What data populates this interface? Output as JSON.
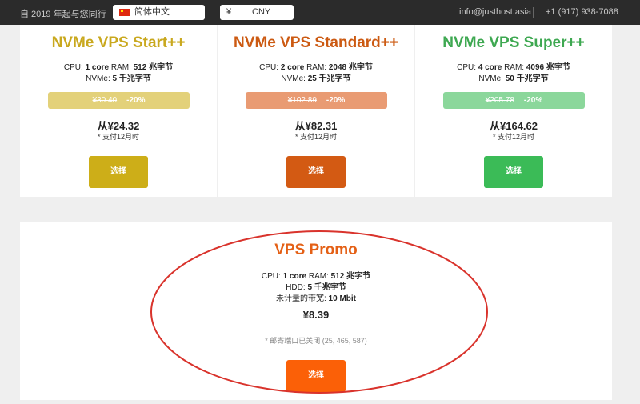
{
  "topbar": {
    "since": "自 2019 年起与您同行",
    "language": "简体中文",
    "currency_symbol": "¥",
    "currency_code": "CNY",
    "email": "info@justhost.asia",
    "phone": "+1 (917) 938-7088"
  },
  "plans": [
    {
      "title": "NVMe VPS Start++",
      "cpu_label": "CPU:",
      "cpu": "1 core",
      "ram_label": "RAM:",
      "ram": "512 兆字节",
      "disk_label": "NVMe:",
      "disk": "5 千兆字节",
      "old_price": "¥30.40",
      "discount": "-20%",
      "price": "从¥24.32",
      "note": "* 支付12月时",
      "button": "选择",
      "title_color": "#c9a81e",
      "disc_color": "#e3d17a",
      "btn_color": "#cdae18"
    },
    {
      "title": "NVMe VPS Standard++",
      "cpu_label": "CPU:",
      "cpu": "2 core",
      "ram_label": "RAM:",
      "ram": "2048 兆字节",
      "disk_label": "NVMe:",
      "disk": "25 千兆字节",
      "old_price": "¥102.89",
      "discount": "-20%",
      "price": "从¥82.31",
      "note": "* 支付12月时",
      "button": "选择",
      "title_color": "#cc5a12",
      "disc_color": "#e99b73",
      "btn_color": "#d35a13"
    },
    {
      "title": "NVMe VPS Super++",
      "cpu_label": "CPU:",
      "cpu": "4 core",
      "ram_label": "RAM:",
      "ram": "4096 兆字节",
      "disk_label": "NVMe:",
      "disk": "50 千兆字节",
      "old_price": "¥205.78",
      "discount": "-20%",
      "price": "从¥164.62",
      "note": "* 支付12月时",
      "button": "选择",
      "title_color": "#3ea851",
      "disc_color": "#8bd79b",
      "btn_color": "#3bbb57"
    }
  ],
  "promo": {
    "title": "VPS Promo",
    "cpu_label": "CPU:",
    "cpu": "1 core",
    "ram_label": "RAM:",
    "ram": "512 兆字节",
    "disk_label": "HDD:",
    "disk": "5 千兆字节",
    "bandwidth_label": "未计量的带宽:",
    "bandwidth": "10 Mbit",
    "price": "¥8.39",
    "note": "* 邮寄端口已关闭 (25, 465, 587)",
    "button": "选择",
    "title_color": "#e46016",
    "btn_color": "#fb6007"
  },
  "annotation_color": "#d9332c"
}
